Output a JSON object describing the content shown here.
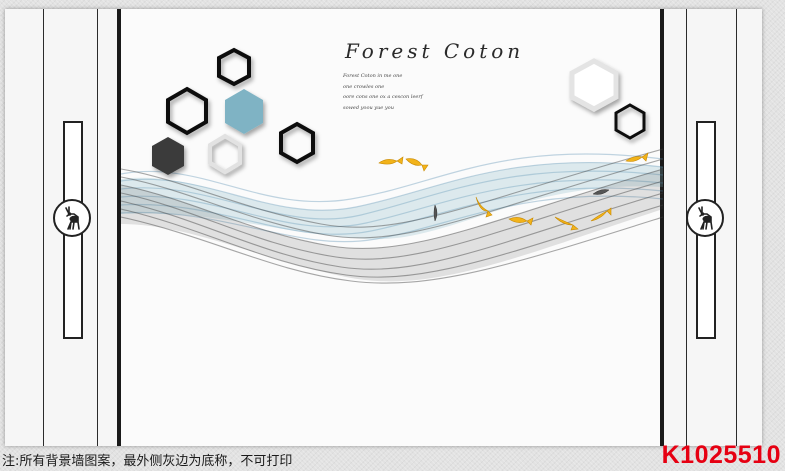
{
  "artwork": {
    "title": "Forest Coton",
    "text_lines": [
      "Forest Coton in me one",
      "one crowles one",
      "oore cons one ox a cescon leerf",
      "sowed yoou yue you"
    ]
  },
  "footer": {
    "note": "注:所有背景墙图案，最外侧灰边为底称，不可打印",
    "product_code": "K1025510"
  },
  "icons": {
    "left_medallion": "deer-icon",
    "right_medallion": "deer-icon"
  },
  "colors": {
    "code_red": "#e60012",
    "frame_black": "#1a1a1a",
    "teal_hexagon": "#7fb3c4",
    "dark_hexagon": "#3a3a3a",
    "gold_fish": "#f2b31a",
    "blue_ribbon": "#4f89b0",
    "gray_ribbon": "#3d3d3d"
  }
}
